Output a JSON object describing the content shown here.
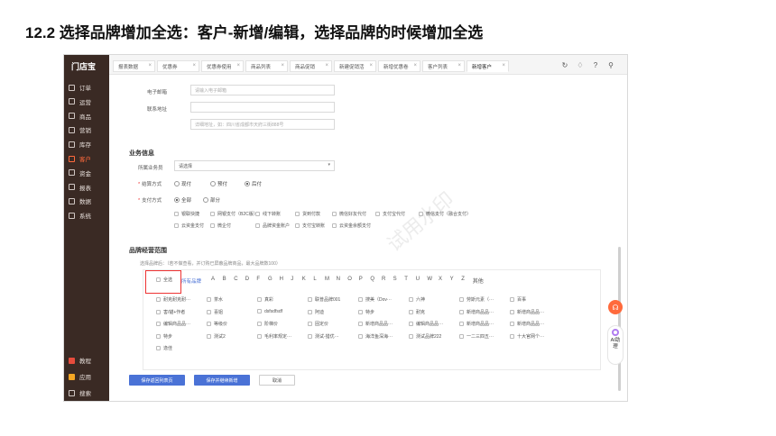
{
  "heading": "12.2 选择品牌增加全选：客户-新增/编辑，选择品牌的时候增加全选",
  "app": {
    "logo": "门店宝"
  },
  "sidebar": {
    "items": [
      {
        "label": "订单",
        "icon": "order-icon"
      },
      {
        "label": "运营",
        "icon": "operation-icon"
      },
      {
        "label": "商品",
        "icon": "product-icon"
      },
      {
        "label": "营销",
        "icon": "marketing-icon"
      },
      {
        "label": "库存",
        "icon": "inventory-icon"
      },
      {
        "label": "客户",
        "icon": "customer-icon",
        "active": true
      },
      {
        "label": "资金",
        "icon": "funds-icon"
      },
      {
        "label": "报表",
        "icon": "report-icon"
      },
      {
        "label": "数据",
        "icon": "data-icon"
      },
      {
        "label": "系统",
        "icon": "system-icon"
      }
    ],
    "bottom_items": [
      {
        "label": "教程",
        "icon": "tutorial-icon"
      },
      {
        "label": "应用",
        "icon": "apps-icon"
      },
      {
        "label": "搜索",
        "icon": "search-icon"
      }
    ]
  },
  "tabs": [
    {
      "label": "报表数据"
    },
    {
      "label": "优惠券"
    },
    {
      "label": "优惠券使用"
    },
    {
      "label": "商品列表"
    },
    {
      "label": "商品促销"
    },
    {
      "label": "新建促销活"
    },
    {
      "label": "新增优惠卷"
    },
    {
      "label": "客户列表"
    },
    {
      "label": "新增客户",
      "active": true
    }
  ],
  "form": {
    "email_label": "电子邮箱",
    "email_placeholder": "请输入电子邮箱",
    "address_label": "联系地址",
    "address_placeholder": "",
    "address_detail_placeholder": "详细地址，如：四川省成都市天府三街888号",
    "business_title": "业务信息",
    "salesman_label": "所属业务员",
    "salesman_value": "请选择",
    "settlement_label": "结算方式",
    "settlement_options": [
      "现付",
      "预付",
      "后付"
    ],
    "settlement_selected": "后付",
    "payment_label": "支付方式",
    "payment_options": [
      "全部",
      "部分"
    ],
    "payment_selected": "全部",
    "payment_methods": [
      "银联快捷",
      "网银支付（B2C版）",
      "线下转账",
      "货到付款",
      "微信好友代付",
      "支付宝代付",
      "微信支付（融合支付）",
      "云资金支付",
      "微企付",
      "品牌资金账户",
      "支付宝转账",
      "云资金余额支付"
    ],
    "brand_title": "品牌经营范围",
    "brand_hint": "选择品牌后：（若不做查看，并订购已屏蔽品牌商品，最大品牌数100）",
    "select_all_label": "全选",
    "all_brands_label": "所有品牌",
    "letters": [
      "A",
      "B",
      "C",
      "D",
      "F",
      "G",
      "H",
      "J",
      "K",
      "L",
      "M",
      "N",
      "O",
      "P",
      "Q",
      "R",
      "S",
      "T",
      "U",
      "W",
      "X",
      "Y",
      "Z",
      "其他"
    ],
    "brands": [
      "耐克耐克耐···",
      "茶水",
      "真彩",
      "联普品牌001",
      "搜美（Dov···",
      "六神",
      "劳斯元素（···",
      "百事",
      "害/锚+作者",
      "喜姐",
      "dsfsdfsdf",
      "阿迪",
      "特步",
      "耐克",
      "新增商品品···",
      "新增商品品···",
      "编辑商品品···",
      "等级价",
      "阶梯价",
      "固定价",
      "新增商品品···",
      "编辑商品品···",
      "新增商品品···",
      "新增商品品···",
      "特步",
      "测试2",
      "毛利率规定···",
      "测试-猎优···",
      "海洋鱼深海···",
      "测试品牌222",
      "一二三四五···",
      "十大官网个···",
      "逸佳"
    ],
    "save_return_label": "保存返回列表页",
    "save_continue_label": "保存并继续新增",
    "cancel_label": "取消"
  },
  "watermark": "试用水印",
  "ai_assistant": "AI助理",
  "colors": {
    "sidebar": "#3a2a24",
    "accent": "#ff6a3c",
    "primary": "#4a72d6",
    "highlight": "#e33333"
  }
}
